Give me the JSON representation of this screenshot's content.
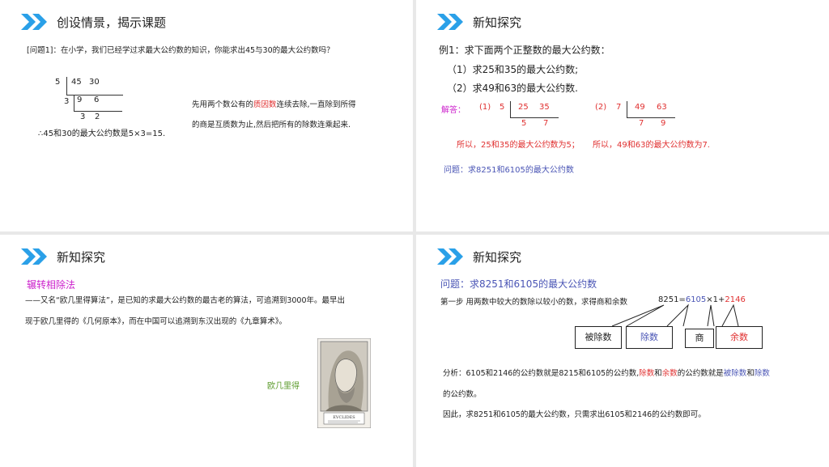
{
  "slide1": {
    "title": "创设情景，揭示课题",
    "question": "[问题1]：在小学，我们已经学过求最大公约数的知识，你能求出45与30的最大公约数吗？",
    "division": {
      "r1_div": "5",
      "r1_a": "45",
      "r1_b": "30",
      "r2_div": "3",
      "r2_a": "9",
      "r2_b": "6",
      "r3_a": "3",
      "r3_b": "2"
    },
    "conclusion": "∴45和30的最大公约数是5×3=15.",
    "explain_pre": "先用两个数公有的",
    "explain_red": "质因数",
    "explain_post": "连续去除,一直除到所得",
    "explain_line2": "的商是互质数为止,然后把所有的除数连乘起来."
  },
  "slide2": {
    "title": "新知探究",
    "example": "例1：求下面两个正整数的最大公约数：",
    "item1": "（1）求25和35的最大公约数;",
    "item2": "（2）求49和63的最大公约数.",
    "solution_label": "解答：",
    "part1": {
      "label": "(1)",
      "div": "5",
      "a": "25",
      "b": "35",
      "qa": "5",
      "qb": "7"
    },
    "part2": {
      "label": "(2)",
      "div": "7",
      "a": "49",
      "b": "63",
      "qa": "7",
      "qb": "9"
    },
    "result1": "所以，25和35的最大公约数为5；",
    "result2": "所以，49和63的最大公约数为7.",
    "question": "问题：求8251和6105的最大公约数"
  },
  "slide3": {
    "title": "新知探究",
    "heading": "辗转相除法",
    "para_line1": "——又名“欧几里得算法”，是已知的求最大公约数的最古老的算法，可追溯到3000年。最早出",
    "para_line2": "现于欧几里得的《几何原本》，而在中国可以追溯到东汉出现的《九章算术》。",
    "portrait_caption": "欧几里得",
    "portrait_plate_text": "EVCLIDES"
  },
  "slide4": {
    "title": "新知探究",
    "question": "问题：求8251和6105的最大公约数",
    "step_text": "第一步  用两数中较大的数除以较小的数，求得商和余数",
    "eq_a": "8251=",
    "eq_b": "6105",
    "eq_c": "×1+",
    "eq_d": "2146",
    "box1": "被除数",
    "box2": "除数",
    "box3": "商",
    "box4": "余数",
    "analysis_1": "分析：6105和2146的公约数就是8215和6105的公约数,",
    "analysis_red1": "除数",
    "analysis_and1": "和",
    "analysis_red2": "余数",
    "analysis_mid": "的公约数就是",
    "analysis_blue1": "被除数",
    "analysis_and2": "和",
    "analysis_blue2": "除数",
    "analysis_2": "的公约数。",
    "therefore": "因此，求8251和6105的最大公约数，只需求出6105和2146的公约数即可。"
  },
  "colors": {
    "chevron": "#2aa0e8",
    "red": "#e03030",
    "blue": "#4a55b5",
    "magenta": "#cc22cc",
    "green": "#5a9a2a"
  }
}
